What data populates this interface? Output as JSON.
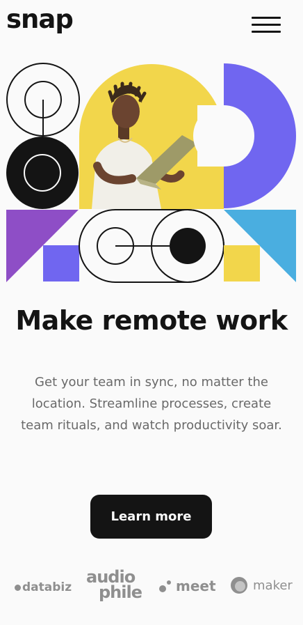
{
  "brand": {
    "logo_text": "snap"
  },
  "nav": {
    "menu_icon": "hamburger-menu-icon"
  },
  "hero": {
    "photo_alt": "Man with laptop on yellow background",
    "colors": {
      "yellow": "#f2d64b",
      "purple": "#7066f0",
      "violet": "#8e4ec6",
      "sky": "#4aaee0",
      "black": "#141414"
    }
  },
  "main": {
    "headline": "Make remote work",
    "description": "Get your team in sync, no matter the location. Streamline processes, create team rituals, and watch productivity soar.",
    "cta_label": "Learn more"
  },
  "clients": {
    "items": [
      {
        "name": "databiz",
        "text": "databiz"
      },
      {
        "name": "audiophile",
        "line1": "audio",
        "line2": "phile"
      },
      {
        "name": "meet",
        "text": "meet"
      },
      {
        "name": "maker",
        "text": "maker"
      }
    ]
  }
}
